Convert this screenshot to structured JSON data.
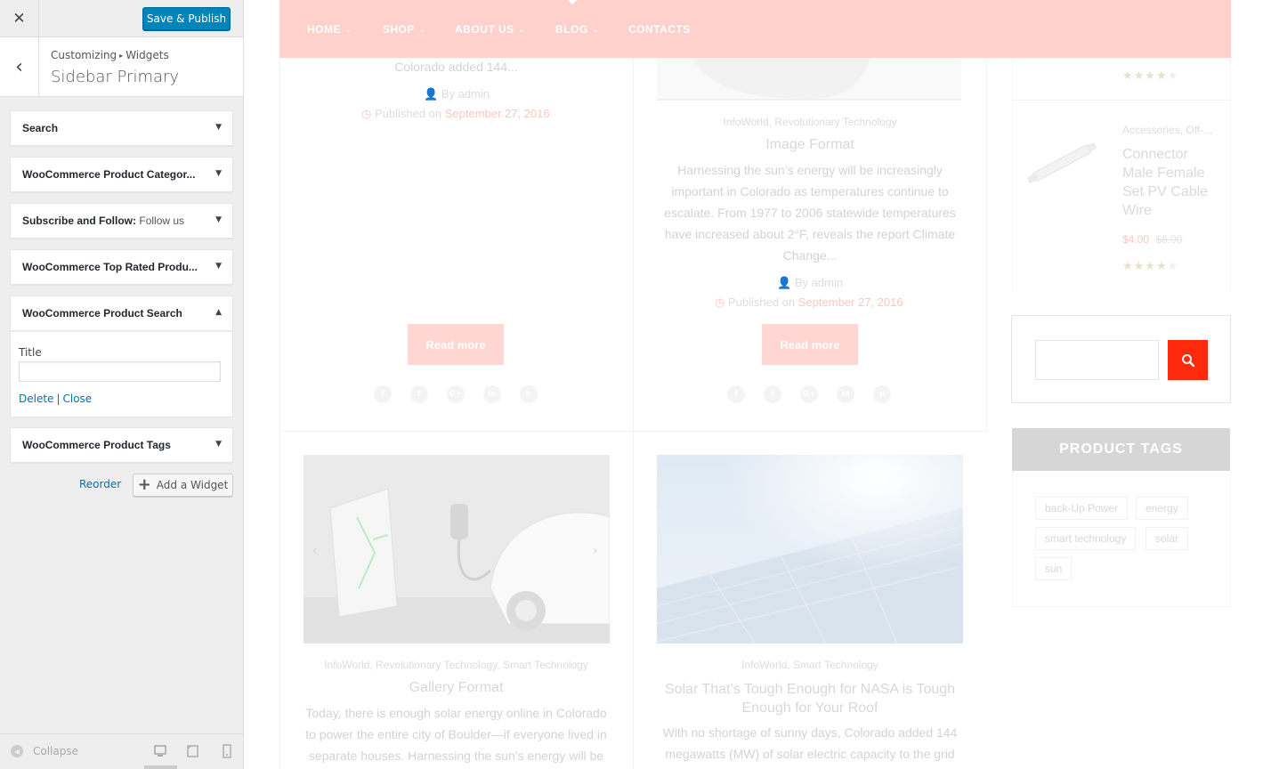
{
  "customizer": {
    "save_label": "Save & Publish",
    "breadcrumb_root": "Customizing",
    "breadcrumb_sep": "▸",
    "breadcrumb_section": "Widgets",
    "section_title": "Sidebar Primary",
    "widgets": [
      {
        "title": "Search",
        "subtitle": ""
      },
      {
        "title": "WooCommerce Product Categor...",
        "subtitle": ""
      },
      {
        "title": "Subscribe and Follow:",
        "subtitle": "Follow us"
      },
      {
        "title": "WooCommerce Top Rated Produ...",
        "subtitle": ""
      },
      {
        "title": "WooCommerce Product Search",
        "subtitle": ""
      },
      {
        "title": "WooCommerce Product Tags",
        "subtitle": ""
      }
    ],
    "open_widget": {
      "field_label": "Title",
      "field_value": "",
      "delete_label": "Delete",
      "separator": "|",
      "close_label": "Close"
    },
    "reorder_label": "Reorder",
    "add_widget_label": "Add a Widget",
    "collapse_label": "Collapse"
  },
  "preview": {
    "nav": [
      "HOME",
      "SHOP",
      "ABOUT US",
      "BLOG",
      "CONTACTS"
    ],
    "post1": {
      "excerpt_tail": "Colorado added 144...",
      "author": "By admin",
      "published_prefix": "Published on",
      "date": "September 27, 2016",
      "read_more": "Read more"
    },
    "post2": {
      "categories": "InfoWorld, Revolutionary Technology",
      "title": "Image Format",
      "excerpt": "Harnessing the sun’s energy will be increasingly important in Colorado as temperatures continue to escalate. From 1977 to 2006 statewide temperatures have increased about 2°F, reveals the report Climate Change...",
      "author": "By admin",
      "published_prefix": "Published on",
      "date": "September 27, 2016",
      "read_more": "Read more"
    },
    "post3": {
      "categories": "InfoWorld, Revolutionary Technology, Smart Technology",
      "title": "Gallery Format",
      "excerpt": "Today, there is enough solar energy online in Colorado to power the entire city of Boulder—if everyone lived in separate houses. Harnessing the sun’s energy will be"
    },
    "post4": {
      "categories": "InfoWorld, Smart Technology",
      "title": "Solar That’s Tough Enough for NASA is Tough Enough for Your Roof",
      "excerpt": "With no shortage of sunny days, Colorado added 144 megawatts (MW) of solar electric capacity to the grid"
    },
    "product": {
      "category": "Accessories, Off-...",
      "name": "Connector Male Female Set PV Cable Wire",
      "price": "$4.00",
      "old_price": "$6.00",
      "rating": 4,
      "rating_out_of": 5
    },
    "top_rating": 4,
    "search_placeholder": "",
    "tags_title": "PRODUCT TAGS",
    "tags": [
      "back-Up Power",
      "energy",
      "smart technology",
      "solar",
      "sun"
    ],
    "social": [
      "f",
      "t",
      "G+",
      "in",
      "p"
    ]
  }
}
